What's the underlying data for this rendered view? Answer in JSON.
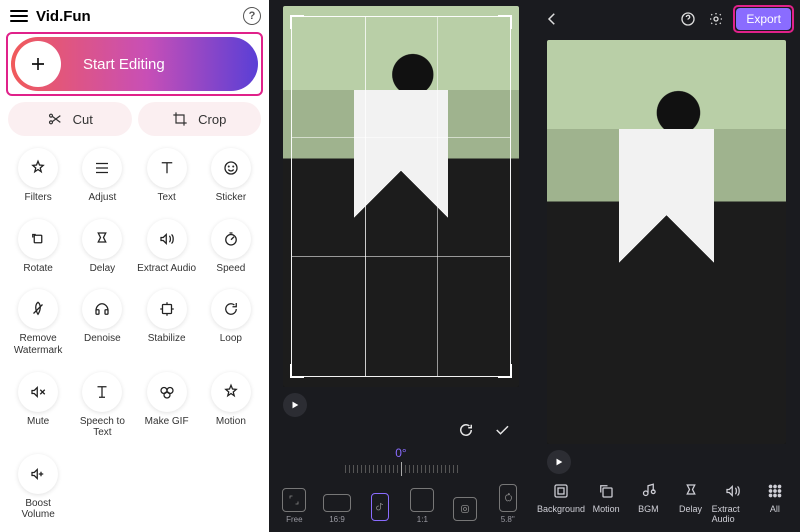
{
  "app": {
    "title": "Vid.Fun"
  },
  "start": {
    "label": "Start Editing"
  },
  "quick": {
    "cut": "Cut",
    "crop": "Crop"
  },
  "tools": [
    {
      "id": "filters",
      "label": "Filters"
    },
    {
      "id": "adjust",
      "label": "Adjust"
    },
    {
      "id": "text",
      "label": "Text"
    },
    {
      "id": "sticker",
      "label": "Sticker"
    },
    {
      "id": "rotate",
      "label": "Rotate"
    },
    {
      "id": "delay",
      "label": "Delay"
    },
    {
      "id": "extract-audio",
      "label": "Extract Audio"
    },
    {
      "id": "speed",
      "label": "Speed"
    },
    {
      "id": "remove-watermark",
      "label": "Remove Watermark"
    },
    {
      "id": "denoise",
      "label": "Denoise"
    },
    {
      "id": "stabilize",
      "label": "Stabilize"
    },
    {
      "id": "loop",
      "label": "Loop"
    },
    {
      "id": "mute",
      "label": "Mute"
    },
    {
      "id": "speech-to-text",
      "label": "Speech to Text"
    },
    {
      "id": "make-gif",
      "label": "Make GIF"
    },
    {
      "id": "motion",
      "label": "Motion"
    },
    {
      "id": "boost-volume",
      "label": "Boost Volume"
    }
  ],
  "crop": {
    "angle": "0°",
    "ratios": [
      {
        "id": "free",
        "label": "Free",
        "selected": false
      },
      {
        "id": "16-9",
        "label": "16:9",
        "selected": false
      },
      {
        "id": "tiktok",
        "label": "",
        "selected": true
      },
      {
        "id": "1-1",
        "label": "1:1",
        "selected": false
      },
      {
        "id": "ig",
        "label": "",
        "selected": false
      },
      {
        "id": "apple",
        "label": "5.8\"",
        "selected": false
      }
    ]
  },
  "export": {
    "button": "Export",
    "tools": [
      {
        "id": "background",
        "label": "Background"
      },
      {
        "id": "motion",
        "label": "Motion"
      },
      {
        "id": "bgm",
        "label": "BGM"
      },
      {
        "id": "delay",
        "label": "Delay"
      },
      {
        "id": "extract-audio",
        "label": "Extract Audio"
      },
      {
        "id": "all",
        "label": "All"
      }
    ]
  }
}
